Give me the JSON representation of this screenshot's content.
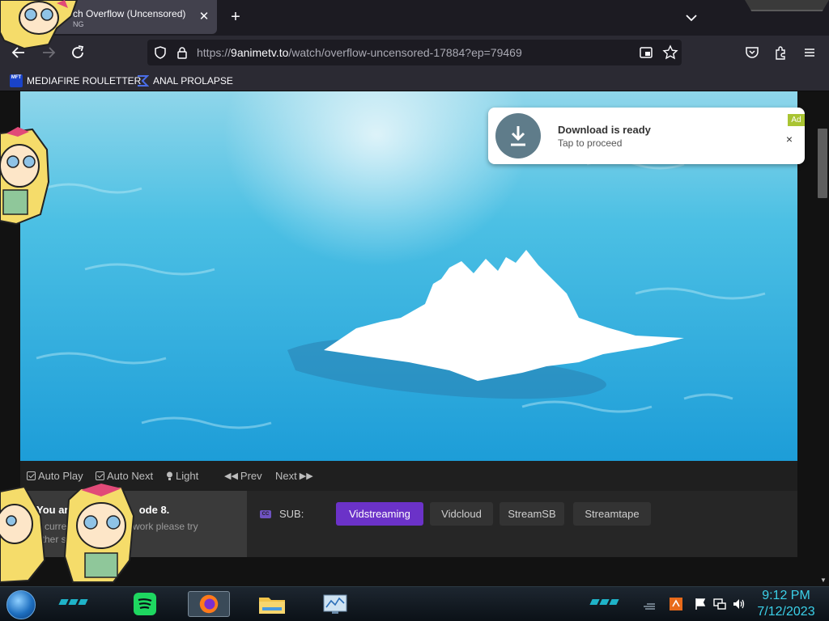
{
  "browser": {
    "tab": {
      "title": "ch Overflow (Uncensored)",
      "subtitle": "NG"
    },
    "url": {
      "prefix": "https://",
      "host": "9animetv.to",
      "path": "/watch/overflow-uncensored-17884?ep=79469"
    },
    "bookmarks": [
      {
        "label": "MEDIAFIRE ROULETTER",
        "icon": "mft-icon",
        "icon_text": "MFT"
      },
      {
        "label": "ANAL PROLAPSE",
        "icon": "sigma-icon"
      }
    ]
  },
  "ad": {
    "title": "Download is ready",
    "subtitle": "Tap to proceed",
    "badge": "Ad",
    "close": "×"
  },
  "player": {
    "controls": {
      "auto_play": "Auto Play",
      "auto_next": "Auto Next",
      "light": "Light",
      "prev": "Prev",
      "next": "Next"
    },
    "notice": {
      "title": "You are",
      "title_end": "ode 8.",
      "body_1": "If curre",
      "body_1_end": "sn't work please try",
      "body_2": "other s"
    },
    "sub_label": "SUB:",
    "cc_badge": "CC",
    "servers": [
      {
        "label": "Vidstreaming",
        "active": true
      },
      {
        "label": "Vidcloud",
        "active": false
      },
      {
        "label": "StreamSB",
        "active": false
      },
      {
        "label": "Streamtape",
        "active": false
      }
    ]
  },
  "taskbar": {
    "time": "9:12 PM",
    "date": "7/12/2023"
  },
  "colors": {
    "accent_server": "#6b32c8",
    "ad_badge": "#a9c432",
    "clock": "#3bd0e8"
  }
}
